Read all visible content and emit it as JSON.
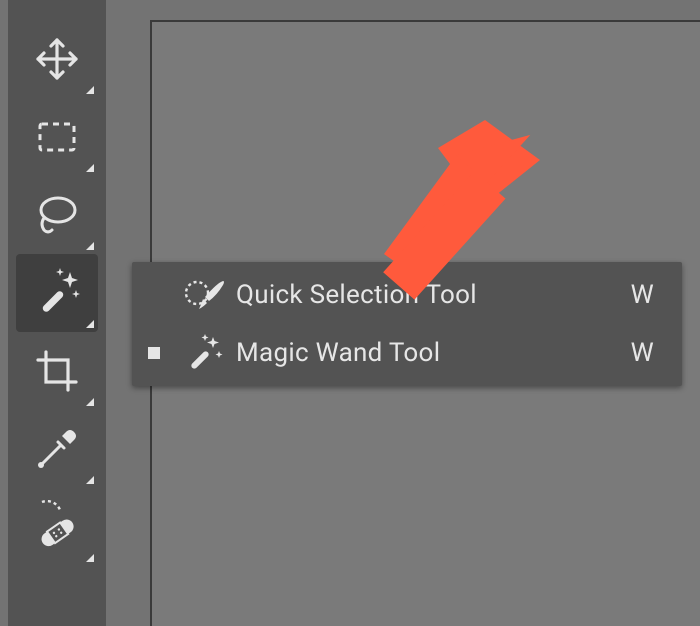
{
  "toolbar": {
    "tools": [
      {
        "id": "move",
        "selected": false,
        "hasFlyout": true
      },
      {
        "id": "marquee",
        "selected": false,
        "hasFlyout": true
      },
      {
        "id": "lasso",
        "selected": false,
        "hasFlyout": true
      },
      {
        "id": "quick-select",
        "selected": true,
        "hasFlyout": true
      },
      {
        "id": "crop",
        "selected": false,
        "hasFlyout": true
      },
      {
        "id": "eyedropper",
        "selected": false,
        "hasFlyout": true
      },
      {
        "id": "healing",
        "selected": false,
        "hasFlyout": true
      }
    ]
  },
  "flyout": {
    "items": [
      {
        "label": "Quick Selection Tool",
        "shortcut": "W",
        "active": false
      },
      {
        "label": "Magic Wand Tool",
        "shortcut": "W",
        "active": true
      }
    ]
  },
  "annotation": {
    "arrow_color": "#ff5a3c"
  }
}
